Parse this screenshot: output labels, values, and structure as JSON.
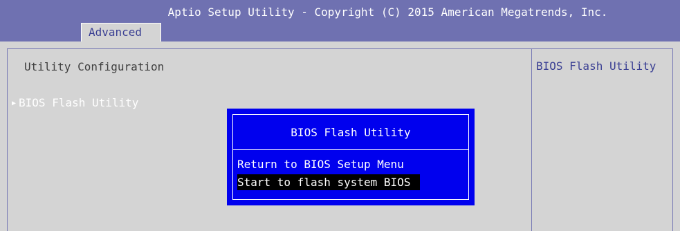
{
  "header": {
    "title": "Aptio Setup Utility - Copyright (C) 2015 American Megatrends, Inc.",
    "active_tab": "Advanced"
  },
  "main": {
    "section_title": "Utility Configuration",
    "items": [
      {
        "label": "BIOS Flash Utility",
        "icon": "triangle-right-icon"
      }
    ]
  },
  "help_panel": {
    "text": "BIOS Flash Utility"
  },
  "dialog": {
    "title": "BIOS Flash Utility",
    "options": [
      {
        "label": "Return to BIOS Setup Menu",
        "selected": false
      },
      {
        "label": "Start to flash system BIOS",
        "selected": true
      }
    ]
  },
  "colors": {
    "header_bg": "#6f71b1",
    "body_bg": "#d4d4d4",
    "dialog_bg": "#0000ee",
    "highlight_bg": "#000000",
    "accent_text": "#3a3f93"
  }
}
